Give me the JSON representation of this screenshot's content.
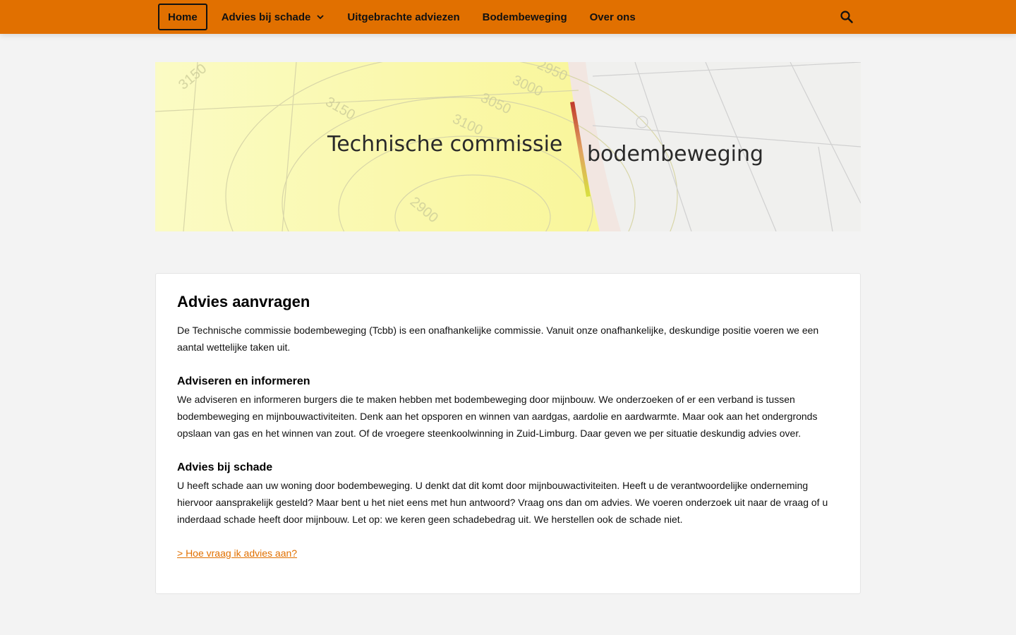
{
  "nav": {
    "items": [
      {
        "label": "Home"
      },
      {
        "label": "Advies bij schade"
      },
      {
        "label": "Uitgebrachte adviezen"
      },
      {
        "label": "Bodembeweging"
      },
      {
        "label": "Over ons"
      }
    ],
    "search_icon": "search-icon"
  },
  "banner": {
    "title_left": "Technische commissie",
    "title_right": "bodembeweging",
    "map_numbers": [
      "3150",
      "3100",
      "3050",
      "3000",
      "2950",
      "3150",
      "2900"
    ]
  },
  "main": {
    "title": "Advies aanvragen",
    "intro": "De Technische commissie bodembeweging (Tcbb) is een onafhankelijke  commissie. Vanuit onze onafhankelijke, deskundige positie voeren we een  aantal wettelijke taken uit.",
    "sections": [
      {
        "heading": "Adviseren en informeren",
        "text": "We adviseren en informeren burgers die te maken hebben met bodembeweging  door mijnbouw. We onderzoeken of er een verband is tussen bodembeweging  en mijnbouwactiviteiten. Denk aan het opsporen en winnen van aardgas,  aardolie en aardwarmte. Maar ook aan het ondergronds opslaan van gas en  het winnen van zout. Of de vroegere steenkoolwinning in Zuid-Limburg.  Daar geven we per situatie deskundig advies over."
      },
      {
        "heading": "Advies bij schade",
        "text": "U heeft  schade aan uw woning door bodembeweging. U denkt dat dit komt door  mijnbouwactiviteiten. Heeft u de verantwoordelijke onderneming hiervoor  aansprakelijk gesteld? Maar bent u het niet eens met hun antwoord? Vraag  ons dan om advies. We voeren onderzoek uit naar de vraag of u inderdaad  schade heeft door mijnbouw. Let op: we keren geen schadebedrag uit. We  herstellen ook de schade niet."
      }
    ],
    "link": "> Hoe vraag ik advies aan?"
  },
  "colors": {
    "brand": "#e17000",
    "background": "#f3f3f3"
  }
}
